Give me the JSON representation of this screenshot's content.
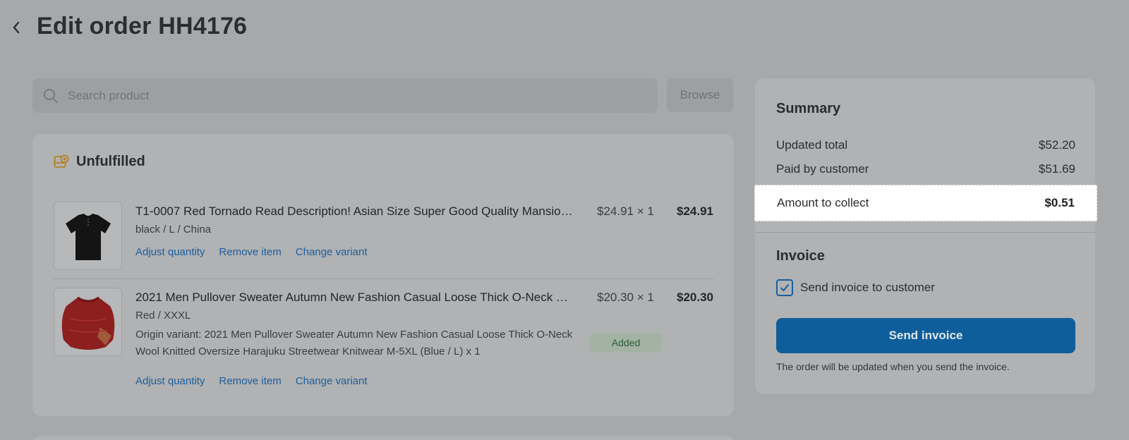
{
  "header": {
    "title": "Edit order HH4176"
  },
  "search": {
    "placeholder": "Search product",
    "browse_label": "Browse"
  },
  "unfulfilled": {
    "title": "Unfulfilled",
    "items": [
      {
        "title": "T1-0007 Red Tornado Read Description! Asian Size Super Good Quality Mansion Tee",
        "variant": "black / L / China",
        "unit_price": "$24.91 × 1",
        "total": "$24.91",
        "actions": [
          "Adjust quantity",
          "Remove item",
          "Change variant"
        ]
      },
      {
        "title": "2021 Men Pullover Sweater Autumn New Fashion Casual Loose Thick O-Neck Wool Knitted",
        "variant": "Red / XXXL",
        "origin": "Origin variant: 2021 Men Pullover Sweater Autumn New Fashion Casual Loose Thick O-Neck Wool Knitted Oversize Harajuku Streetwear Knitwear M-5XL (Blue / L) x 1",
        "unit_price": "$20.30 × 1",
        "total": "$20.30",
        "badge": "Added",
        "actions": [
          "Adjust quantity",
          "Remove item",
          "Change variant"
        ]
      }
    ]
  },
  "summary": {
    "title": "Summary",
    "updated_total_label": "Updated total",
    "updated_total_value": "$52.20",
    "paid_label": "Paid by customer",
    "paid_value": "$51.69",
    "collect_label": "Amount to collect",
    "collect_value": "$0.51"
  },
  "invoice": {
    "title": "Invoice",
    "checkbox_label": "Send invoice to customer",
    "checked": true,
    "send_button": "Send invoice",
    "hint": "The order will be updated when you send the invoice."
  },
  "colors": {
    "overlay_bg": "#a6a8a9",
    "primary_button": "#0f5e9c",
    "link": "#1a5fa0",
    "added_badge_text": "#2e5e37"
  }
}
